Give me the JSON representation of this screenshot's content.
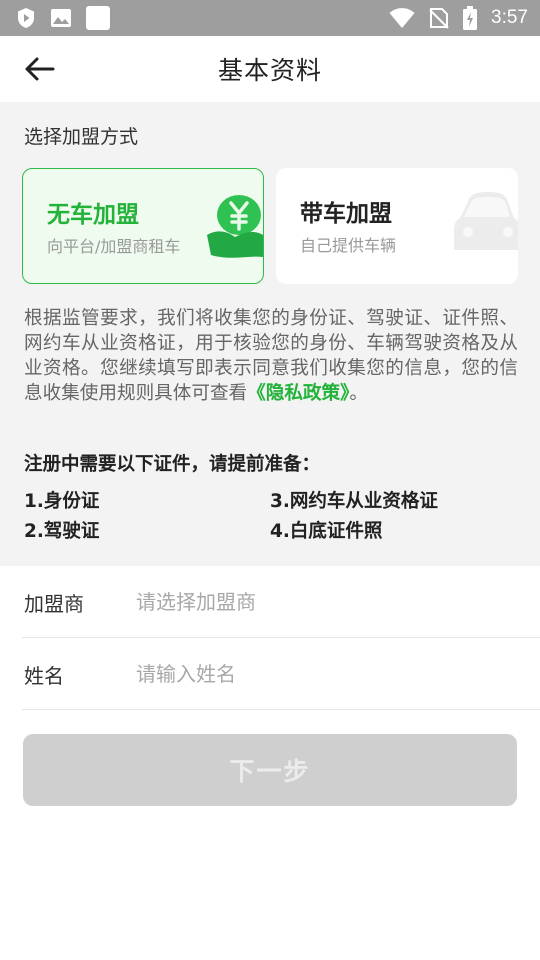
{
  "status_bar": {
    "time": "3:57",
    "icons": [
      "shield-icon",
      "image-icon",
      "app-icon",
      "wifi-icon",
      "no-sim-icon",
      "battery-icon"
    ]
  },
  "header": {
    "title": "基本资料",
    "back_icon": "arrow-left-icon"
  },
  "join_section": {
    "label": "选择加盟方式",
    "options": [
      {
        "title": "无车加盟",
        "subtitle": "向平台/加盟商租车",
        "selected": true,
        "icon": "yen-hand-icon",
        "color": "#23b23a"
      },
      {
        "title": "带车加盟",
        "subtitle": "自己提供车辆",
        "selected": false,
        "icon": "car-icon"
      }
    ]
  },
  "notice": {
    "text": "根据监管要求，我们将收集您的身份证、驾驶证、证件照、网约车从业资格证，用于核验您的身份、车辆驾驶资格及从业资格。您继续填写即表示同意我们收集您的信息，您的信息收集使用规则具体可查看",
    "link": "《隐私政策》",
    "suffix": "。"
  },
  "requirements": {
    "title": "注册中需要以下证件，请提前准备：",
    "items": [
      "1.身份证",
      "2.驾驶证",
      "3.网约车从业资格证",
      "4.白底证件照"
    ]
  },
  "form": {
    "merchant": {
      "label": "加盟商",
      "placeholder": "请选择加盟商"
    },
    "name": {
      "label": "姓名",
      "placeholder": "请输入姓名"
    }
  },
  "next_button": {
    "label": "下一步"
  },
  "colors": {
    "accent": "#23b23a",
    "disabled_button": "#cfcfcf",
    "status_bar": "#9e9e9e"
  }
}
